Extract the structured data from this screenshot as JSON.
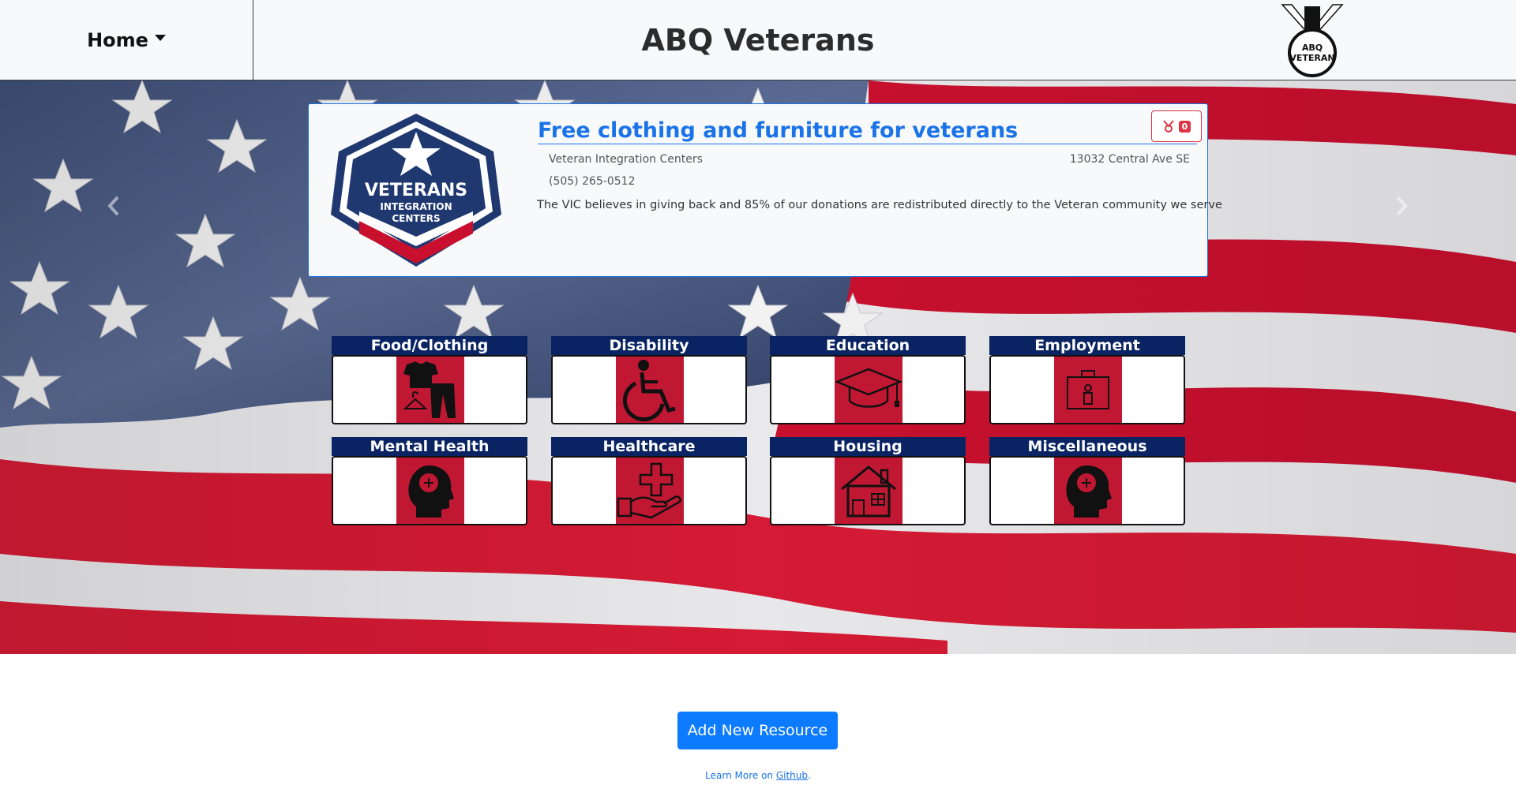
{
  "navbar": {
    "home_label": "Home",
    "title": "ABQ Veterans",
    "logo_text": [
      "ABQ",
      "VETERAN"
    ]
  },
  "featured_resource": {
    "title": "Free clothing and furniture for veterans",
    "organization": "Veteran Integration Centers",
    "address": "13032 Central Ave SE",
    "phone": "(505) 265-0512",
    "description": "The VIC believes in giving back and 85% of our donations are redistributed directly to the Veteran community we serve",
    "favorite_count": "0",
    "logo_text": [
      "VETERANS",
      "INTEGRATION",
      "CENTERS"
    ]
  },
  "categories": [
    {
      "label": "Food/Clothing",
      "icon": "clothing-icon"
    },
    {
      "label": "Disability",
      "icon": "wheelchair-icon"
    },
    {
      "label": "Education",
      "icon": "graduation-cap-icon"
    },
    {
      "label": "Employment",
      "icon": "employee-badge-icon"
    },
    {
      "label": "Mental Health",
      "icon": "mind-head-icon"
    },
    {
      "label": "Healthcare",
      "icon": "medical-hand-icon"
    },
    {
      "label": "Housing",
      "icon": "house-icon"
    },
    {
      "label": "Miscellaneous",
      "icon": "mind-head-icon"
    }
  ],
  "footer": {
    "add_button_label": "Add New Resource",
    "learn_more_prefix": "Learn More on ",
    "learn_more_link": "Github",
    "learn_more_suffix": "."
  },
  "colors": {
    "nav_bg": "#f8f9fa",
    "accent_blue": "#1a73e8",
    "button_blue": "#0d7bfe",
    "tile_label_bg": "#0a2463",
    "tile_icon_bg": "#c01732",
    "favorite_red": "#dc3545"
  }
}
